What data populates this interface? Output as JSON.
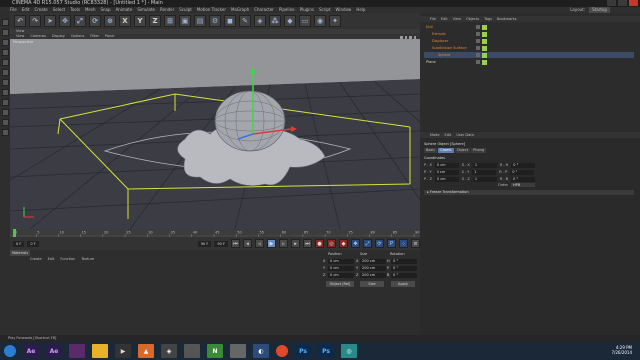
{
  "window": {
    "title": "CINEMA 4D R15.057 Studio (RC83328) - [Untitled 1 *] - Main"
  },
  "menubar": [
    "File",
    "Edit",
    "Create",
    "Select",
    "Tools",
    "Mesh",
    "Snap",
    "Animate",
    "Simulate",
    "Render",
    "Sculpt",
    "Motion Tracker",
    "MoGraph",
    "Character",
    "Pipeline",
    "Plugins",
    "Script",
    "Window",
    "Help"
  ],
  "layout": {
    "label": "Layout:",
    "value": "Startup"
  },
  "toolbar": {
    "x": "X",
    "y": "Y",
    "z": "Z"
  },
  "viewport": {
    "menu": [
      "View",
      "Cameras",
      "Display",
      "Options",
      "Filter",
      "Panel"
    ],
    "label": "Perspective",
    "submenu": [
      "View"
    ]
  },
  "timeline": {
    "ticks": [
      "0",
      "5",
      "10",
      "15",
      "20",
      "25",
      "30",
      "35",
      "40",
      "45",
      "50",
      "55",
      "60",
      "65",
      "70",
      "75",
      "80",
      "85",
      "90"
    ],
    "current_frame": "0 F",
    "start_field": "0 F",
    "start_field2": "0 F",
    "end_field": "90 F",
    "end_field2": "90 F",
    "tooltip": [
      "Play Forwards",
      "Play Forwards",
      "[Shortcut F8]"
    ]
  },
  "materials": {
    "tab": "Materials",
    "menu": [
      "Create",
      "Edit",
      "Function",
      "Texture"
    ]
  },
  "coordinates": {
    "headers": [
      "Position",
      "Size",
      "Rotation"
    ],
    "rows": [
      {
        "axis": "X",
        "pos": "0 cm",
        "axis2": "X",
        "size": "200 cm",
        "axis3": "H",
        "rot": "0 °"
      },
      {
        "axis": "Y",
        "pos": "0 cm",
        "axis2": "Y",
        "size": "200 cm",
        "axis3": "P",
        "rot": "0 °"
      },
      {
        "axis": "Z",
        "pos": "0 cm",
        "axis2": "Z",
        "size": "200 cm",
        "axis3": "B",
        "rot": "0 °"
      }
    ],
    "mode": "Object (Rel)",
    "size_mode": "Size",
    "apply": "Apply"
  },
  "objects": {
    "menu": [
      "File",
      "Edit",
      "View",
      "Objects",
      "Tags",
      "Bookmarks"
    ],
    "items": [
      {
        "name": "Null",
        "indent": 0,
        "selected": false
      },
      {
        "name": "Extrude",
        "indent": 1,
        "selected": false
      },
      {
        "name": "Displacer",
        "indent": 1,
        "selected": false
      },
      {
        "name": "Subdivision Surface",
        "indent": 1,
        "selected": false
      },
      {
        "name": "Sphere",
        "indent": 2,
        "selected": true
      },
      {
        "name": "Plane",
        "indent": 0,
        "selected": false
      }
    ]
  },
  "attributes": {
    "menu": [
      "Mode",
      "Edit",
      "User Data"
    ],
    "title": "Sphere Object [Sphere]",
    "tabs": [
      "Basic",
      "Coord.",
      "Object",
      "Phong"
    ],
    "active_tab": "Coord.",
    "section": "Coordinates",
    "rows": [
      {
        "a": "P . X",
        "av": "0 cm",
        "b": "S . X",
        "bv": "1",
        "c": "R . H",
        "cv": "0 °"
      },
      {
        "a": "P . Y",
        "av": "0 cm",
        "b": "S . Y",
        "bv": "1",
        "c": "R . P",
        "cv": "0 °"
      },
      {
        "a": "P . Z",
        "av": "0 cm",
        "b": "S . Z",
        "bv": "1",
        "c": "R . B",
        "cv": "0 °"
      }
    ],
    "order_label": "Order",
    "order_value": "HPB",
    "freeze": "▸ Freeze Transformation"
  },
  "statusbar": {
    "text": "Play Forwards [Shortcut F8]"
  },
  "taskbar": {
    "time": "4:29 PM",
    "date": "7/26/2014"
  },
  "colors": {
    "accent": "#5b7eb3",
    "grid": "#2f3038",
    "bbox": "#d7e23a"
  }
}
